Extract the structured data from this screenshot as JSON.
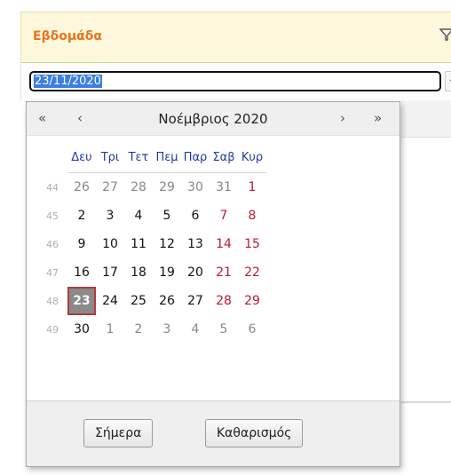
{
  "header": {
    "title": "Εβδομάδα",
    "filter_icon": "filter-icon"
  },
  "input": {
    "value": "23/11/2020"
  },
  "calendar": {
    "nav": {
      "first": "«",
      "prev": "‹",
      "title": "Νοέμβριος 2020",
      "next": "›",
      "last": "»"
    },
    "weekdays": [
      "Δευ",
      "Τρι",
      "Τετ",
      "Πεμ",
      "Παρ",
      "Σαβ",
      "Κυρ"
    ],
    "weeks": [
      {
        "num": "44",
        "days": [
          "26",
          "27",
          "28",
          "29",
          "30",
          "31",
          "1"
        ]
      },
      {
        "num": "45",
        "days": [
          "2",
          "3",
          "4",
          "5",
          "6",
          "7",
          "8"
        ]
      },
      {
        "num": "46",
        "days": [
          "9",
          "10",
          "11",
          "12",
          "13",
          "14",
          "15"
        ]
      },
      {
        "num": "47",
        "days": [
          "16",
          "17",
          "18",
          "19",
          "20",
          "21",
          "22"
        ]
      },
      {
        "num": "48",
        "days": [
          "23",
          "24",
          "25",
          "26",
          "27",
          "28",
          "29"
        ]
      },
      {
        "num": "49",
        "days": [
          "30",
          "1",
          "2",
          "3",
          "4",
          "5",
          "6"
        ]
      }
    ],
    "selected": "23",
    "footer": {
      "today": "Σήμερα",
      "clear": "Καθαρισμός"
    }
  },
  "colors": {
    "title": "#e8741a",
    "weekend": "#c0182f",
    "weekday_header": "#1f3aa6",
    "selected_bg": "#8a8a8a"
  }
}
